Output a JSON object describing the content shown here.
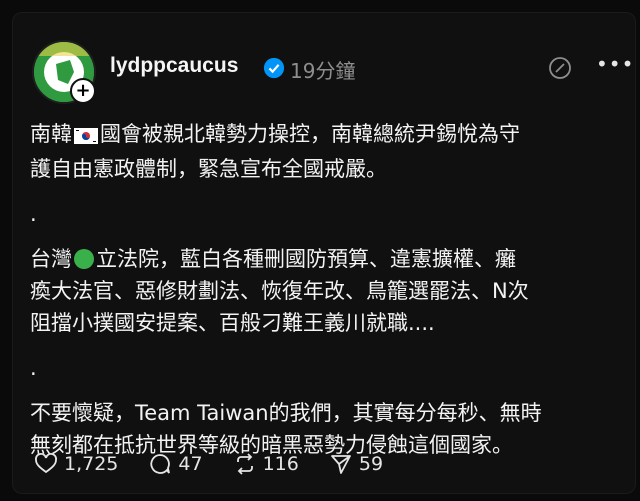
{
  "post": {
    "username": "lydppcaucus",
    "timestamp": "19分鐘",
    "paragraphs": {
      "p1a": "南韓",
      "p1b": "國會被親北韓勢力操控，南韓總統尹錫悅為守",
      "p1c": "護自由憲政體制，緊急宣布全國戒嚴。",
      "dot1": ".",
      "p2a": "台灣",
      "p2b": "立法院，藍白各種刪國防預算、違憲擴權、癱",
      "p2c": "瘓大法官、惡修財劃法、恢復年改、鳥籠選罷法、N次",
      "p2d": "阻擋小撲國安提案、百般刁難王義川就職....",
      "dot2": ".",
      "p3a": "不要懷疑，Team Taiwan的我們，其實每分每秒、無時",
      "p3b": "無刻都在抵抗世界等級的暗黑惡勢力侵蝕這個國家。"
    },
    "stats": {
      "likes": "1,725",
      "comments": "47",
      "reposts": "116",
      "shares": "59"
    }
  },
  "icons": {
    "verified": "verified-badge-icon",
    "edit": "edit-icon",
    "more": "more-icon",
    "like": "heart-icon",
    "comment": "comment-icon",
    "repost": "repost-icon",
    "share": "send-icon"
  },
  "colors": {
    "background": "#101010",
    "verified": "#0095f6",
    "green_dot": "#3ab04a"
  }
}
